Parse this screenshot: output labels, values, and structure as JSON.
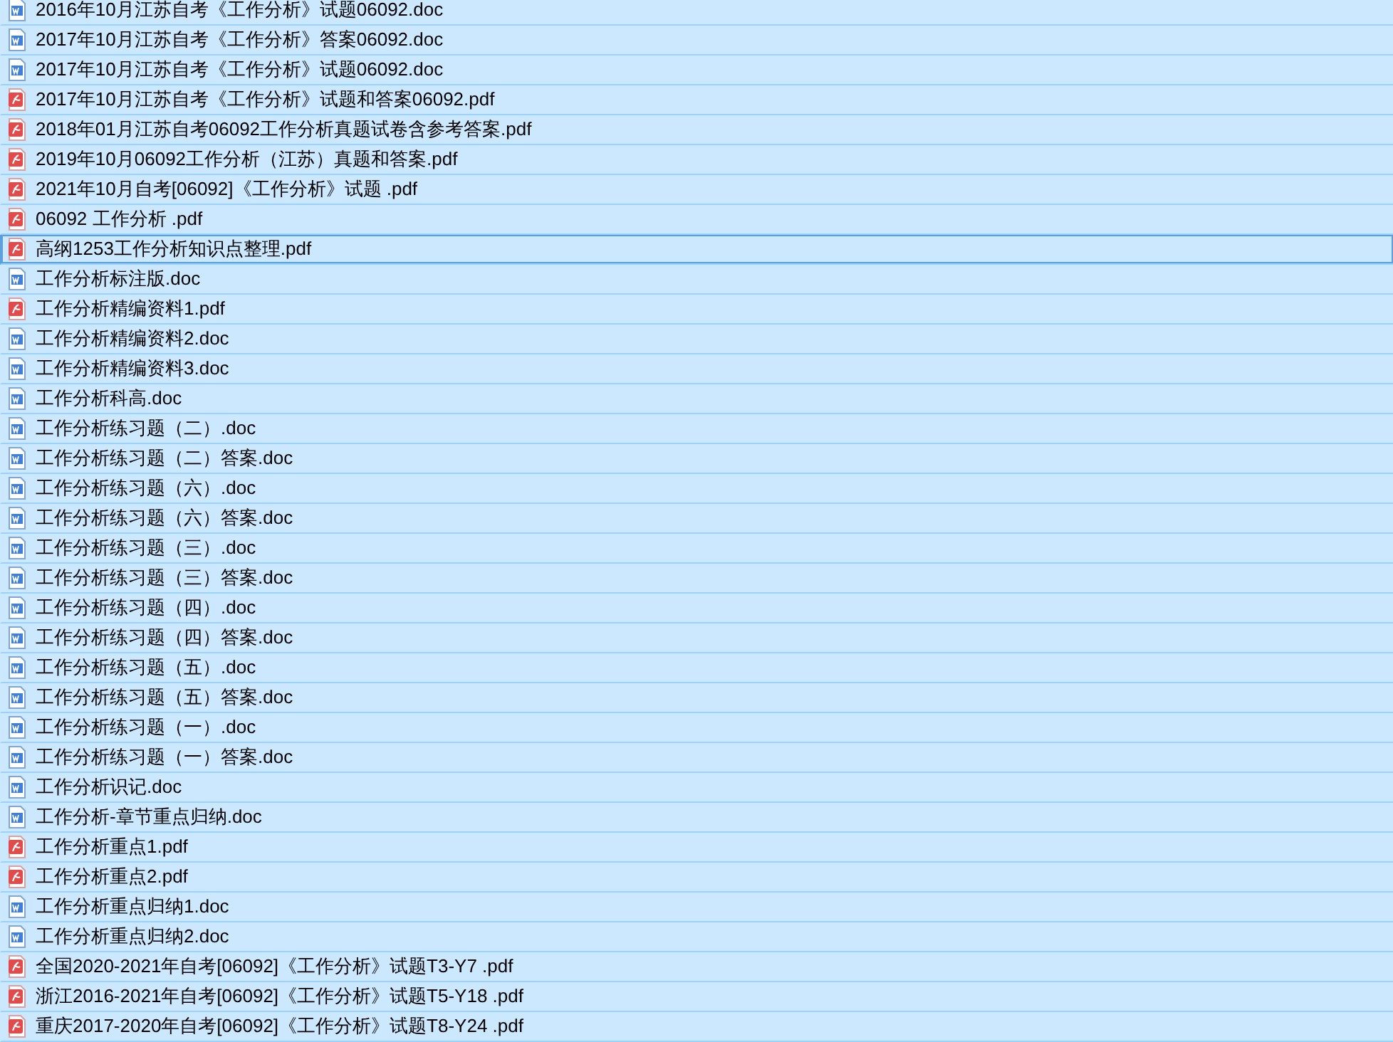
{
  "files": [
    {
      "name": "2016年10月江苏自考《工作分析》试题06092.doc",
      "kind": "doc",
      "selected": true,
      "focused": false
    },
    {
      "name": "2017年10月江苏自考《工作分析》答案06092.doc",
      "kind": "doc",
      "selected": true,
      "focused": false
    },
    {
      "name": "2017年10月江苏自考《工作分析》试题06092.doc",
      "kind": "doc",
      "selected": true,
      "focused": false
    },
    {
      "name": "2017年10月江苏自考《工作分析》试题和答案06092.pdf",
      "kind": "pdf",
      "selected": true,
      "focused": false
    },
    {
      "name": "2018年01月江苏自考06092工作分析真题试卷含参考答案.pdf",
      "kind": "pdf",
      "selected": true,
      "focused": false
    },
    {
      "name": "2019年10月06092工作分析（江苏）真题和答案.pdf",
      "kind": "pdf",
      "selected": true,
      "focused": false
    },
    {
      "name": "2021年10月自考[06092]《工作分析》试题 .pdf",
      "kind": "pdf",
      "selected": true,
      "focused": false
    },
    {
      "name": "06092 工作分析 .pdf",
      "kind": "pdf",
      "selected": true,
      "focused": false
    },
    {
      "name": "高纲1253工作分析知识点整理.pdf",
      "kind": "pdf",
      "selected": true,
      "focused": true
    },
    {
      "name": "工作分析标注版.doc",
      "kind": "doc",
      "selected": true,
      "focused": false
    },
    {
      "name": "工作分析精编资料1.pdf",
      "kind": "pdf",
      "selected": true,
      "focused": false
    },
    {
      "name": "工作分析精编资料2.doc",
      "kind": "doc",
      "selected": true,
      "focused": false
    },
    {
      "name": "工作分析精编资料3.doc",
      "kind": "doc",
      "selected": true,
      "focused": false
    },
    {
      "name": "工作分析科高.doc",
      "kind": "doc",
      "selected": true,
      "focused": false
    },
    {
      "name": "工作分析练习题（二）.doc",
      "kind": "doc",
      "selected": true,
      "focused": false
    },
    {
      "name": "工作分析练习题（二）答案.doc",
      "kind": "doc",
      "selected": true,
      "focused": false
    },
    {
      "name": "工作分析练习题（六）.doc",
      "kind": "doc",
      "selected": true,
      "focused": false
    },
    {
      "name": "工作分析练习题（六）答案.doc",
      "kind": "doc",
      "selected": true,
      "focused": false
    },
    {
      "name": "工作分析练习题（三）.doc",
      "kind": "doc",
      "selected": true,
      "focused": false
    },
    {
      "name": "工作分析练习题（三）答案.doc",
      "kind": "doc",
      "selected": true,
      "focused": false
    },
    {
      "name": "工作分析练习题（四）.doc",
      "kind": "doc",
      "selected": true,
      "focused": false
    },
    {
      "name": "工作分析练习题（四）答案.doc",
      "kind": "doc",
      "selected": true,
      "focused": false
    },
    {
      "name": "工作分析练习题（五）.doc",
      "kind": "doc",
      "selected": true,
      "focused": false
    },
    {
      "name": "工作分析练习题（五）答案.doc",
      "kind": "doc",
      "selected": true,
      "focused": false
    },
    {
      "name": "工作分析练习题（一）.doc",
      "kind": "doc",
      "selected": true,
      "focused": false
    },
    {
      "name": "工作分析练习题（一）答案.doc",
      "kind": "doc",
      "selected": true,
      "focused": false
    },
    {
      "name": "工作分析识记.doc",
      "kind": "doc",
      "selected": true,
      "focused": false
    },
    {
      "name": "工作分析-章节重点归纳.doc",
      "kind": "doc",
      "selected": true,
      "focused": false
    },
    {
      "name": "工作分析重点1.pdf",
      "kind": "pdf",
      "selected": true,
      "focused": false
    },
    {
      "name": "工作分析重点2.pdf",
      "kind": "pdf",
      "selected": true,
      "focused": false
    },
    {
      "name": "工作分析重点归纳1.doc",
      "kind": "doc",
      "selected": true,
      "focused": false
    },
    {
      "name": "工作分析重点归纳2.doc",
      "kind": "doc",
      "selected": true,
      "focused": false
    },
    {
      "name": "全国2020-2021年自考[06092]《工作分析》试题T3-Y7 .pdf",
      "kind": "pdf",
      "selected": true,
      "focused": false
    },
    {
      "name": "浙江2016-2021年自考[06092]《工作分析》试题T5-Y18 .pdf",
      "kind": "pdf",
      "selected": true,
      "focused": false
    },
    {
      "name": "重庆2017-2020年自考[06092]《工作分析》试题T8-Y24 .pdf",
      "kind": "pdf",
      "selected": true,
      "focused": false
    }
  ]
}
